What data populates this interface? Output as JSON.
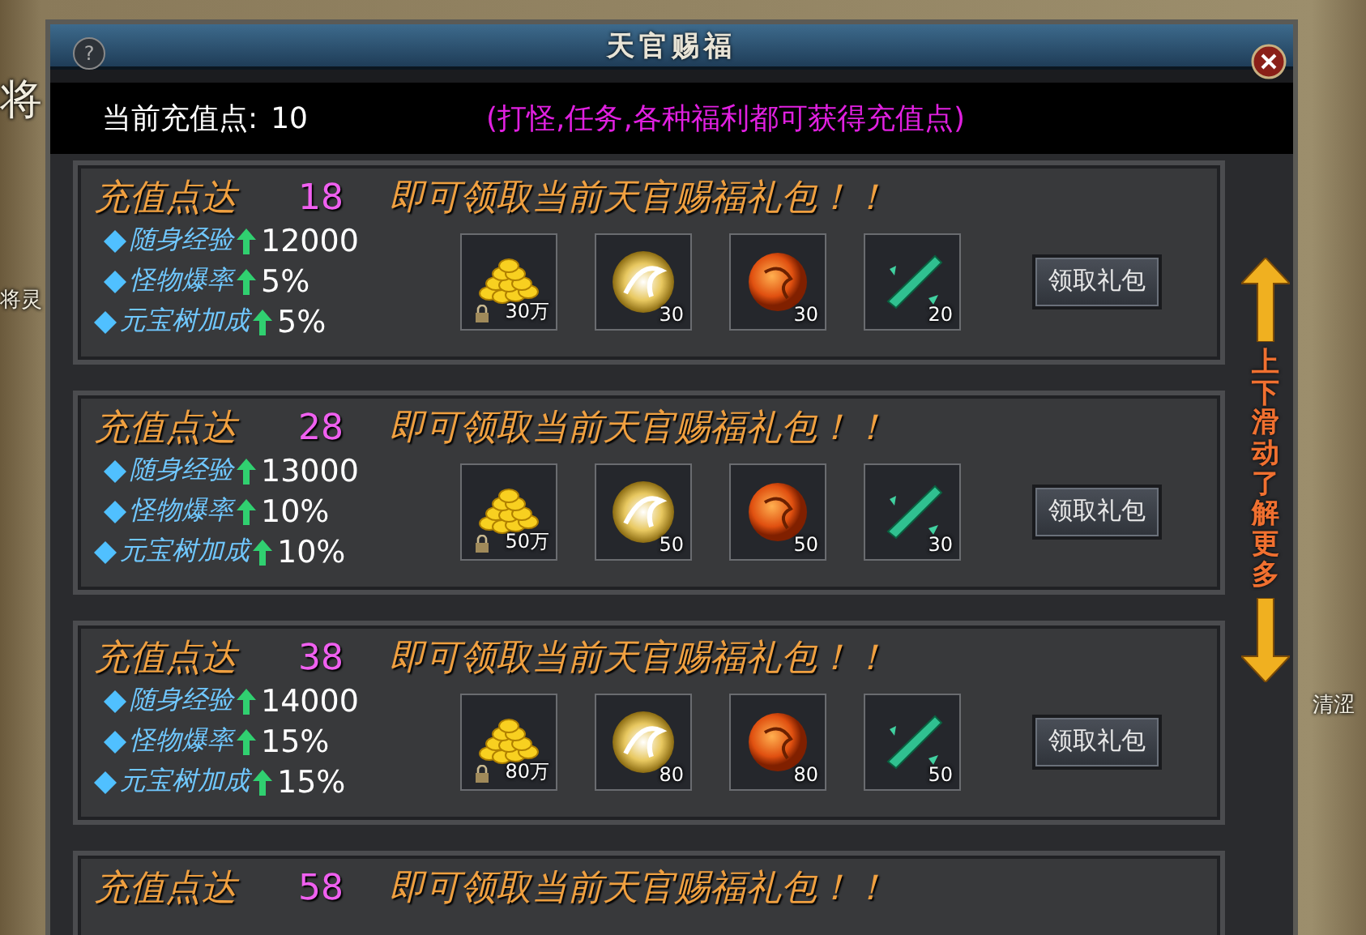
{
  "scene": {
    "labels": [
      {
        "text": "将",
        "kind": "big"
      },
      {
        "text": "将灵",
        "kind": "small"
      },
      {
        "text": "清涩",
        "kind": "name"
      }
    ]
  },
  "window": {
    "title": "天官赐福",
    "help": "?"
  },
  "header": {
    "points_label": "当前充值点:",
    "points": "10",
    "hint": "(打怪,任务,各种福利都可获得充值点)"
  },
  "tiers": [
    {
      "label": "充值点达",
      "points": "18",
      "message": "即可领取当前天官赐福礼包！！",
      "stats": [
        {
          "name": "随身经验",
          "value": "12000"
        },
        {
          "name": "怪物爆率",
          "value": "5%"
        },
        {
          "name": "元宝树加成",
          "value": "5%"
        }
      ],
      "rewards": [
        {
          "kind": "gold",
          "count": "30万",
          "locked": true
        },
        {
          "kind": "swirl",
          "count": "30",
          "locked": false
        },
        {
          "kind": "dragon",
          "count": "30",
          "locked": false
        },
        {
          "kind": "crystal",
          "count": "20",
          "locked": false
        }
      ],
      "button": "领取礼包"
    },
    {
      "label": "充值点达",
      "points": "28",
      "message": "即可领取当前天官赐福礼包！！",
      "stats": [
        {
          "name": "随身经验",
          "value": "13000"
        },
        {
          "name": "怪物爆率",
          "value": "10%"
        },
        {
          "name": "元宝树加成",
          "value": "10%"
        }
      ],
      "rewards": [
        {
          "kind": "gold",
          "count": "50万",
          "locked": true
        },
        {
          "kind": "swirl",
          "count": "50",
          "locked": false
        },
        {
          "kind": "dragon",
          "count": "50",
          "locked": false
        },
        {
          "kind": "crystal",
          "count": "30",
          "locked": false
        }
      ],
      "button": "领取礼包"
    },
    {
      "label": "充值点达",
      "points": "38",
      "message": "即可领取当前天官赐福礼包！！",
      "stats": [
        {
          "name": "随身经验",
          "value": "14000"
        },
        {
          "name": "怪物爆率",
          "value": "15%"
        },
        {
          "name": "元宝树加成",
          "value": "15%"
        }
      ],
      "rewards": [
        {
          "kind": "gold",
          "count": "80万",
          "locked": true
        },
        {
          "kind": "swirl",
          "count": "80",
          "locked": false
        },
        {
          "kind": "dragon",
          "count": "80",
          "locked": false
        },
        {
          "kind": "crystal",
          "count": "50",
          "locked": false
        }
      ],
      "button": "领取礼包"
    },
    {
      "label": "充值点达",
      "points": "58",
      "message": "即可领取当前天官赐福礼包！！"
    }
  ],
  "scroll_hint": "上下滑动了解更多"
}
